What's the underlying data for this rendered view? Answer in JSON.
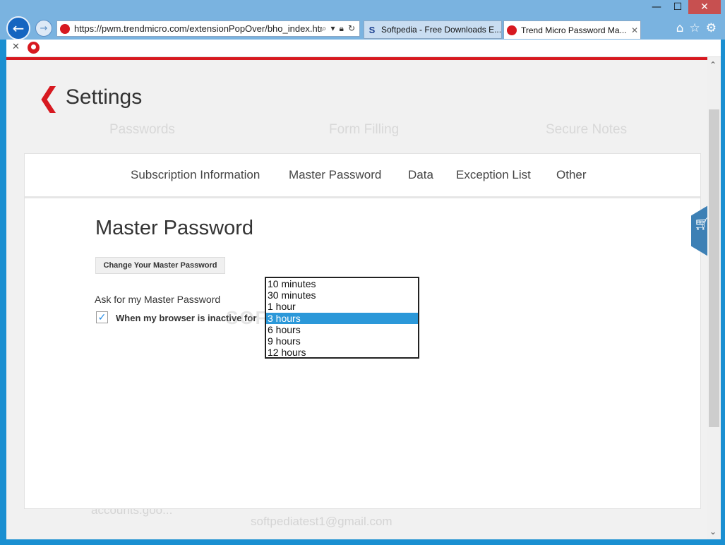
{
  "browser": {
    "address": "https://pwm.trendmicro.com/extensionPopOver/bho_index.htn",
    "tabs": [
      {
        "label": "Softpedia - Free Downloads E...",
        "close": ""
      },
      {
        "label": "Trend Micro Password Ma...",
        "close": "✕"
      }
    ],
    "window_buttons": {
      "minimize": "—",
      "maximize": "☐",
      "close": "✕"
    }
  },
  "settings": {
    "title": "Settings",
    "background_tabs": [
      "Passwords",
      "Form Filling",
      "Secure Notes"
    ],
    "ghost_email": "softpediatest1@gmail.com",
    "ghost_account": "accounts.goo..."
  },
  "panel": {
    "tabs": [
      "Subscription Information",
      "Master Password",
      "Data",
      "Exception List",
      "Other"
    ],
    "heading": "Master Password",
    "change_button": "Change Your Master Password",
    "ask_label": "Ask for my Master Password",
    "inactive_label": "When my browser is inactive for",
    "watermark": "SOFTPEDIA",
    "dropdown": {
      "options": [
        "10 minutes",
        "30 minutes",
        "1 hour",
        "3 hours",
        "6 hours",
        "9 hours",
        "12 hours"
      ],
      "selected": "3 hours"
    }
  },
  "colors": {
    "accent": "#d71920",
    "selection": "#2b98d9",
    "chrome": "#7ab3e0"
  }
}
